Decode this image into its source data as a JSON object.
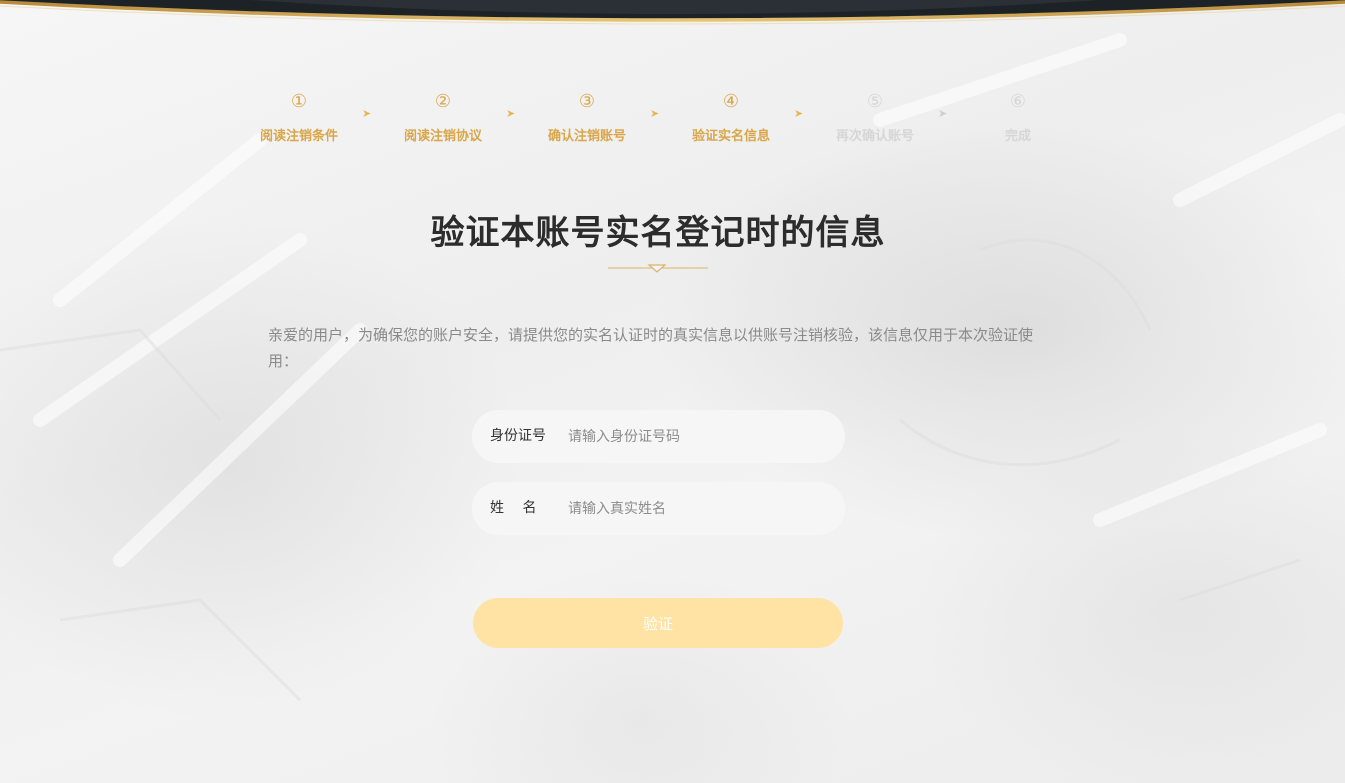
{
  "steps": [
    {
      "num": "①",
      "label": "阅读注销条件",
      "state": "active"
    },
    {
      "num": "②",
      "label": "阅读注销协议",
      "state": "active"
    },
    {
      "num": "③",
      "label": "确认注销账号",
      "state": "active"
    },
    {
      "num": "④",
      "label": "验证实名信息",
      "state": "active"
    },
    {
      "num": "⑤",
      "label": "再次确认账号",
      "state": "inactive"
    },
    {
      "num": "⑥",
      "label": "完成",
      "state": "inactive"
    }
  ],
  "arrow_glyph": "➤",
  "title": "验证本账号实名登记时的信息",
  "notice": "亲爱的用户，为确保您的账户安全，请提供您的实名认证时的真实信息以供账号注销核验，该信息仅用于本次验证使用：",
  "form": {
    "id_card": {
      "label": "身份证号",
      "placeholder": "请输入身份证号码"
    },
    "name": {
      "label": "姓　 名",
      "placeholder": "请输入真实姓名"
    },
    "submit_label": "验证"
  },
  "colors": {
    "accent_gold": "#d9a64a",
    "inactive_gray": "#d6d6d6",
    "button_bg": "#fee3a4",
    "title_text": "#2c2c2c"
  }
}
